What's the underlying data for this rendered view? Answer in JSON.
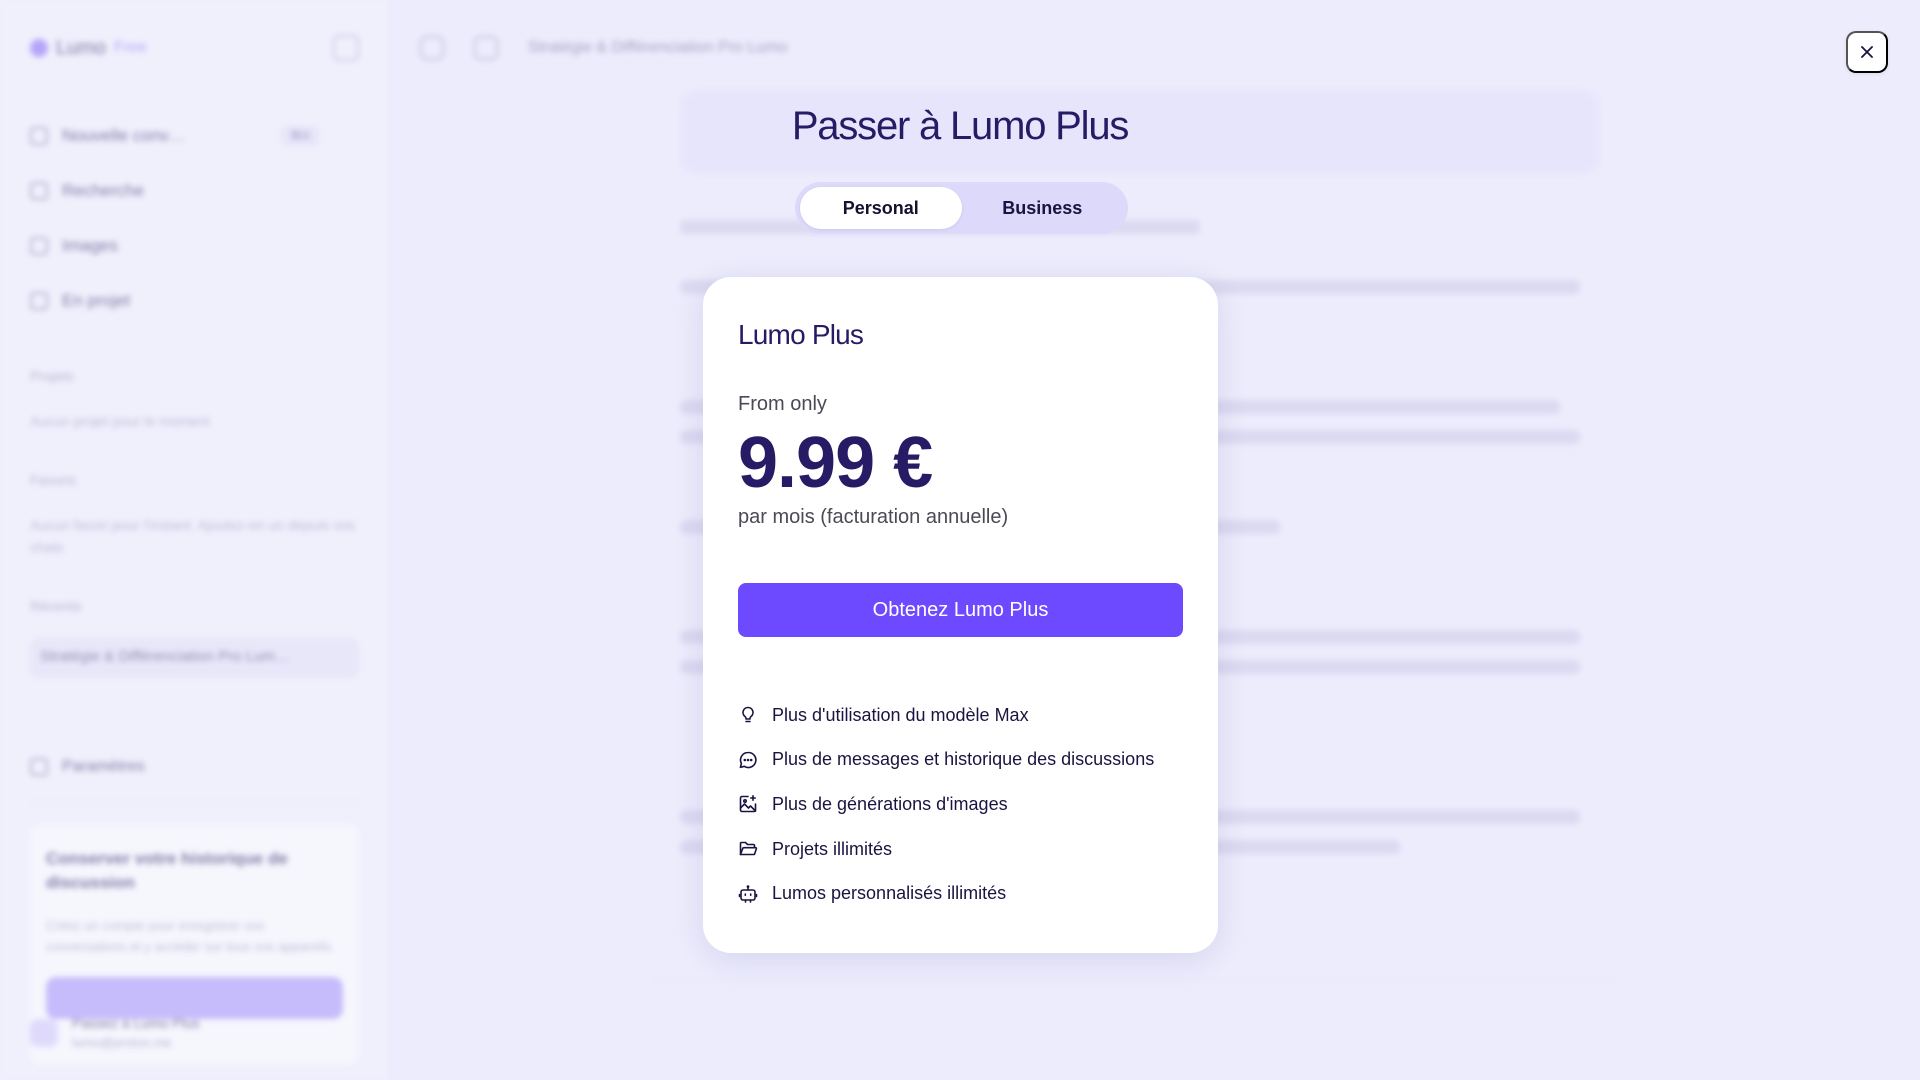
{
  "background": {
    "brand_name": "Lumo",
    "brand_tag": "Free",
    "nav_items": [
      {
        "label": "Nouvelle conv…",
        "shortcut": "⌘K"
      },
      {
        "label": "Recherche"
      },
      {
        "label": "Images"
      },
      {
        "label": "En projet"
      }
    ],
    "sections": [
      {
        "title": "Projets",
        "text": "Aucun projet pour le moment"
      },
      {
        "title": "Favoris",
        "text": "Aucun favori pour l'instant. Ajoutez-en un depuis vos chats"
      },
      {
        "title": "Récents",
        "text": ""
      }
    ],
    "recent_chat": "Stratégie & Différenciation Pro Lum…",
    "settings_label": "Paramètres",
    "promo_title": "Conserver votre historique de discussion",
    "promo_text": "Créez un compte pour enregistrer vos conversations et y accéder sur tous vos appareils.",
    "user_name": "Passez à Lumo Plus",
    "user_email": "lumo@proton.me",
    "header_title": "Stratégie & Différenciation Pro Lumo"
  },
  "modal": {
    "close_label": "×",
    "title": "Passer à Lumo Plus",
    "tabs": [
      {
        "label": "Personal",
        "active": true
      },
      {
        "label": "Business",
        "active": false
      }
    ],
    "card": {
      "plan_name": "Lumo Plus",
      "from_label": "From only",
      "price": "9.99 €",
      "period": "par mois (facturation annuelle)",
      "cta_label": "Obtenez Lumo Plus",
      "features": [
        {
          "icon": "lightbulb-icon",
          "label": "Plus d'utilisation du modèle Max"
        },
        {
          "icon": "chat-bubble-icon",
          "label": "Plus de messages et historique des discussions"
        },
        {
          "icon": "image-sparkle-icon",
          "label": "Plus de générations d'images"
        },
        {
          "icon": "folder-open-icon",
          "label": "Projets illimités"
        },
        {
          "icon": "bot-icon",
          "label": "Lumos personnalisés illimités"
        }
      ]
    }
  },
  "colors": {
    "accent": "#6d4aff",
    "title": "#281b66",
    "backdrop": "#ececfc"
  }
}
